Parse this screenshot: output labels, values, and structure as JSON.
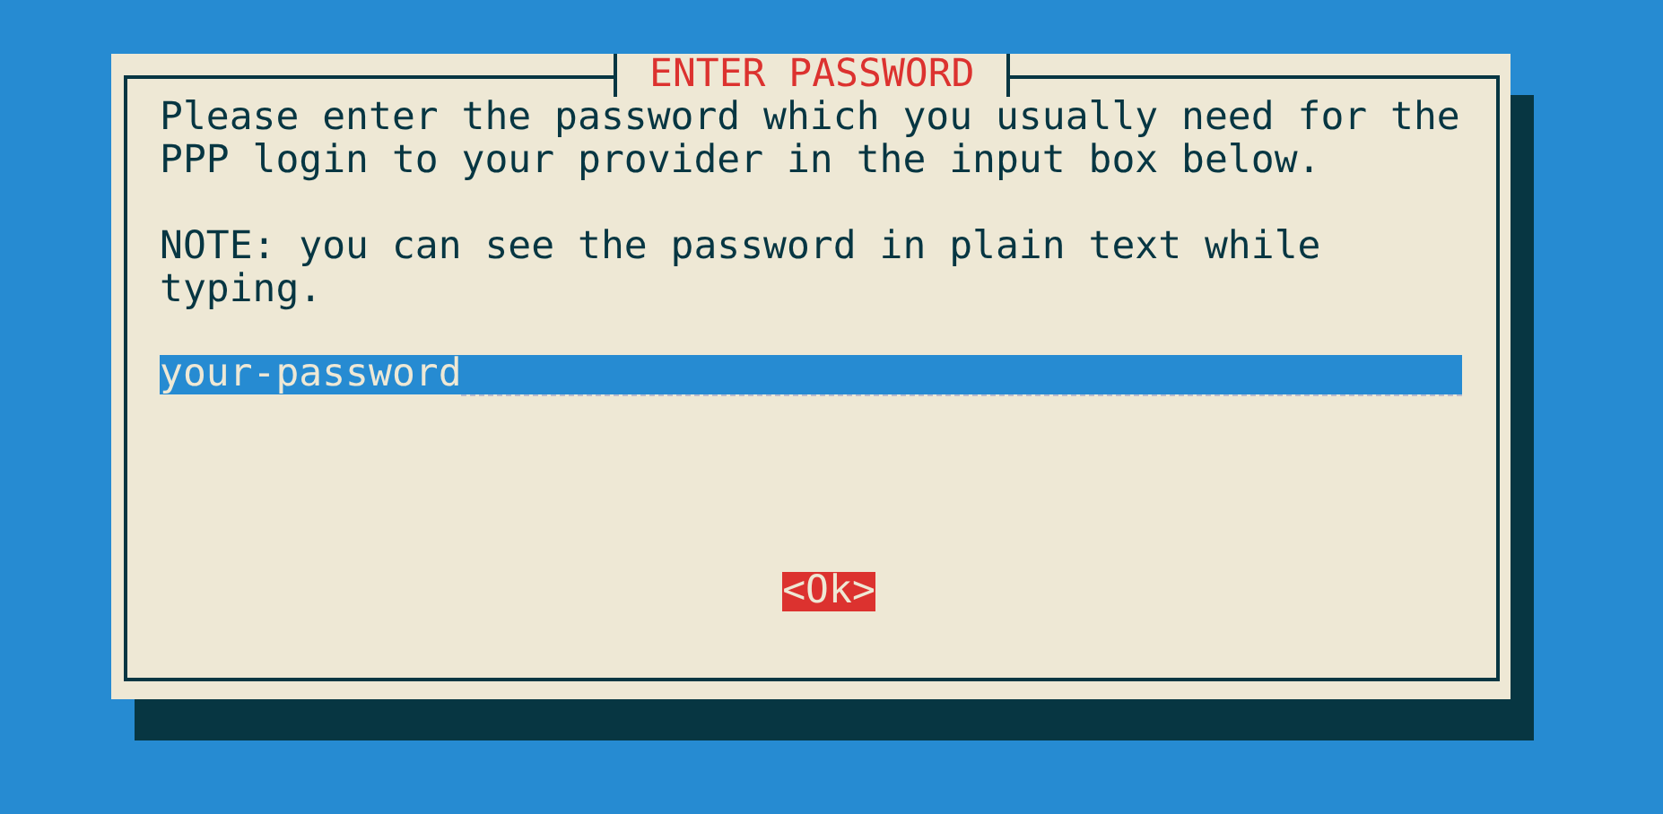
{
  "dialog": {
    "title": "ENTER PASSWORD",
    "paragraphs": [
      "Please enter the password which you usually need for the PPP login to your provider in the input box below.",
      "NOTE: you can see the password in plain text while typing."
    ],
    "input": {
      "value": "your-password"
    },
    "buttons": [
      {
        "label": "<Ok>"
      }
    ]
  }
}
